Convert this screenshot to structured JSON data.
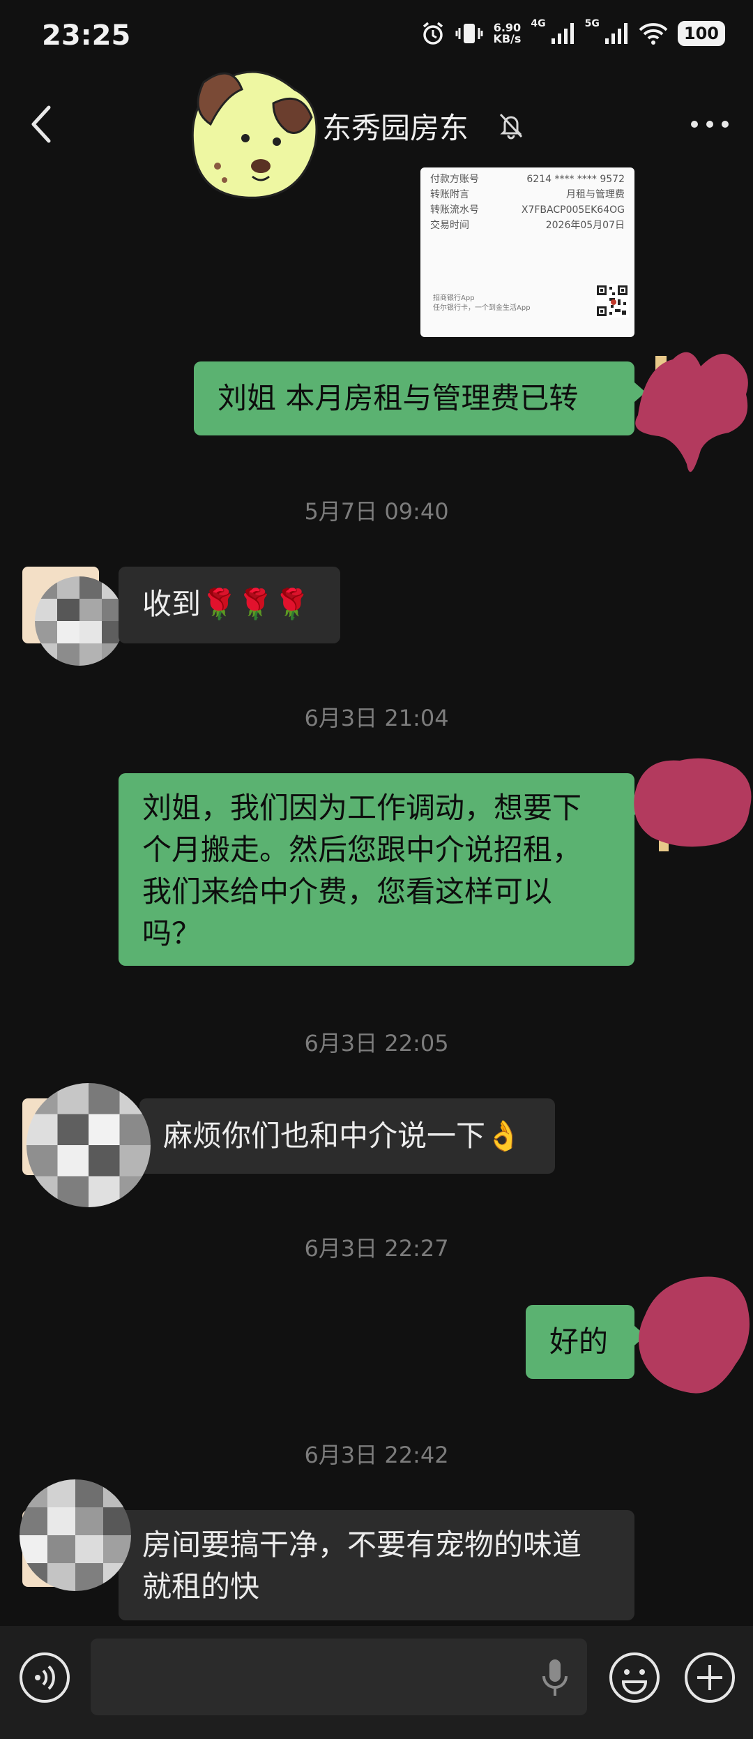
{
  "status_bar": {
    "time": "23:25",
    "net_speed_value": "6.90",
    "net_speed_unit": "KB/s",
    "signal_1": "4G",
    "signal_2": "5G",
    "battery": "100"
  },
  "header": {
    "title": "东秀园房东"
  },
  "receipt": {
    "rows": [
      {
        "label": "付款方账号",
        "value": "6214 **** **** 9572"
      },
      {
        "label": "转账附言",
        "value": "月租与管理费"
      },
      {
        "label": "转账流水号",
        "value": "X7FBACP005EK64OG"
      },
      {
        "label": "交易时间",
        "value": "2026年05月07日"
      }
    ],
    "footer_line1": "招商银行App",
    "footer_line2": "任尔银行卡，一个到金生活App"
  },
  "messages": [
    {
      "text": "刘姐 本月房租与管理费已转"
    },
    {
      "timestamp": "5月7日 09:40"
    },
    {
      "text": "收到🌹🌹🌹"
    },
    {
      "timestamp": "6月3日 21:04"
    },
    {
      "lines": [
        "刘姐，我们因为工作调动，想要下",
        "个月搬走。然后您跟中介说招租，",
        "我们来给中介费，您看这样可以",
        "吗？"
      ]
    },
    {
      "timestamp": "6月3日 22:05"
    },
    {
      "text": "麻烦你们也和中介说一下👌"
    },
    {
      "timestamp": "6月3日 22:27"
    },
    {
      "text": "好的"
    },
    {
      "timestamp": "6月3日 22:42"
    },
    {
      "lines": [
        "房间要搞干净，不要有宠物的味道",
        "就租的快"
      ]
    }
  ],
  "colors": {
    "background": "#111111",
    "my_bubble": "#5bb271",
    "other_bubble": "#2c2c2c",
    "redaction": "#b33a5e"
  },
  "icons": [
    "back-arrow-icon",
    "mute-bell-icon",
    "more-icon",
    "voice-icon",
    "mic-icon",
    "emoji-icon",
    "add-icon"
  ]
}
